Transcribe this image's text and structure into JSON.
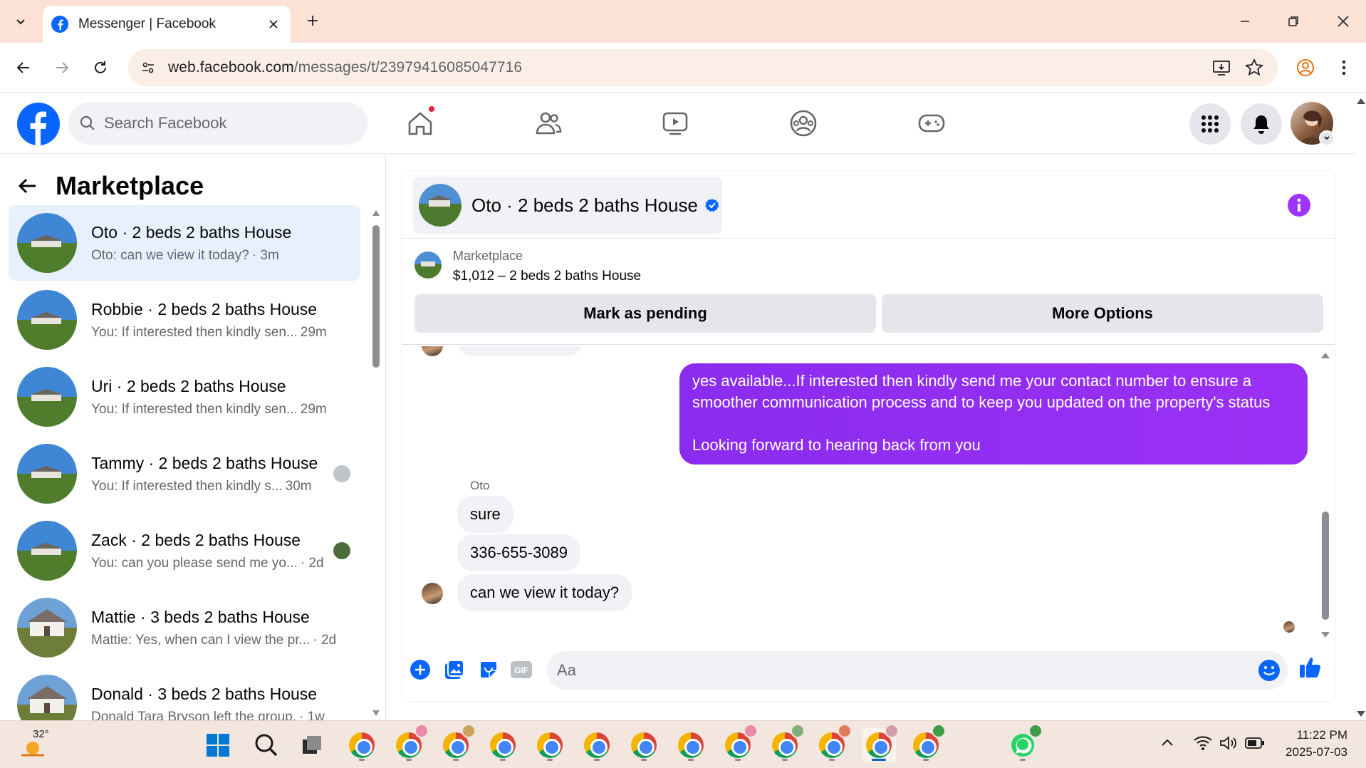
{
  "browser": {
    "tab_title": "Messenger | Facebook",
    "url_host": "web.facebook.com",
    "url_path": "/messages/t/23979416085047716"
  },
  "fb": {
    "search_placeholder": "Search Facebook"
  },
  "left_panel": {
    "title": "Marketplace",
    "conversations": [
      {
        "name": "Oto · 2 beds 2 baths House",
        "preview": "Oto: can we view it today?",
        "time": "· 3m",
        "active": true
      },
      {
        "name": "Robbie · 2 beds 2 baths House",
        "preview": "You: If interested then kindly sen...",
        "time": "29m"
      },
      {
        "name": "Uri · 2 beds 2 baths House",
        "preview": "You: If interested then kindly sen...",
        "time": "29m"
      },
      {
        "name": "Tammy · 2 beds 2 baths House",
        "preview": "You: If interested then kindly s...",
        "time": "30m"
      },
      {
        "name": "Zack · 2 beds 2 baths House",
        "preview": "You: can you please send me yo...",
        "time": "· 2d"
      },
      {
        "name": "Mattie · 3 beds 2 baths House",
        "preview": "Mattie: Yes, when can I view the pr...",
        "time": "· 2d"
      },
      {
        "name": "Donald · 3 beds 2 baths House",
        "preview": "Donald Tara Bryson left the group.",
        "time": "· 1w"
      }
    ]
  },
  "chat": {
    "title": "Oto · 2 beds 2 baths House",
    "marketplace_label": "Marketplace",
    "listing": "$1,012 – 2 beds 2 baths House",
    "btn_pending": "Mark as pending",
    "btn_more": "More Options",
    "outgoing_line1": "yes available...If interested then kindly send me your contact number to ensure a",
    "outgoing_line2": "smoother communication process and to keep you updated on the property's status",
    "outgoing_line3": "Looking forward to hearing back from you",
    "sender_name": "Oto",
    "incoming": [
      "sure",
      "336-655-3089",
      "can we view it today?"
    ],
    "input_placeholder": "Aa"
  },
  "taskbar": {
    "weather_temp": "32°",
    "time": "11:22 PM",
    "date": "2025-07-03"
  },
  "colors": {
    "fb_blue": "#0866ff",
    "messenger_purple": "#9b30f5",
    "accent_active_row": "#e7f0fd"
  }
}
